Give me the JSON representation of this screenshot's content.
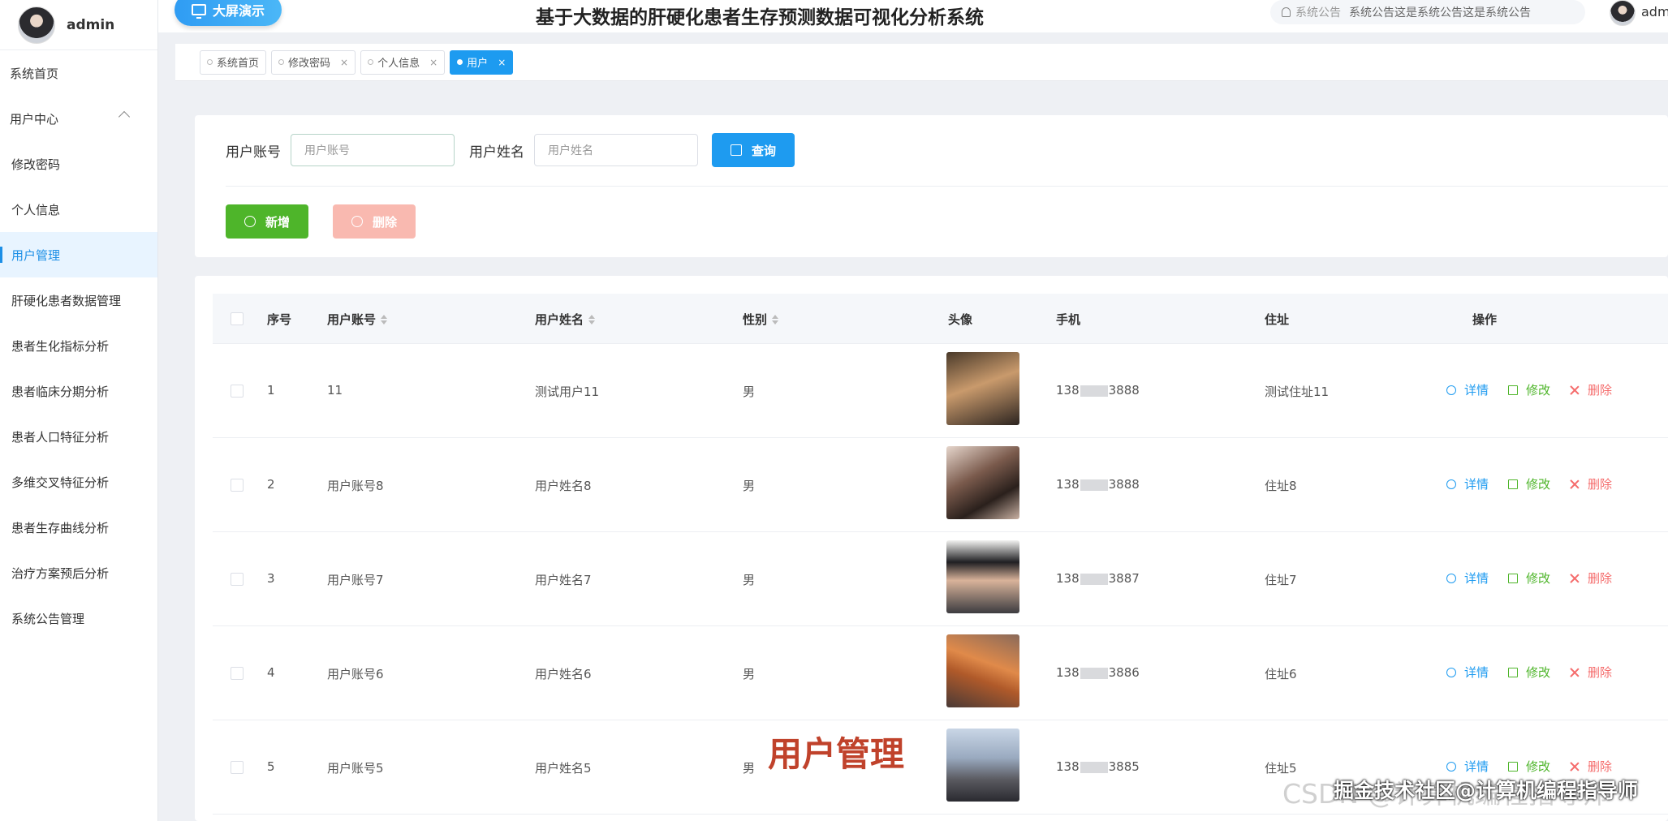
{
  "sidebar": {
    "username": "admin",
    "items": [
      {
        "label": "系统首页"
      },
      {
        "label": "用户中心"
      },
      {
        "label": "修改密码"
      },
      {
        "label": "个人信息"
      },
      {
        "label": "用户管理"
      },
      {
        "label": "肝硬化患者数据管理"
      },
      {
        "label": "患者生化指标分析"
      },
      {
        "label": "患者临床分期分析"
      },
      {
        "label": "患者人口特征分析"
      },
      {
        "label": "多维交叉特征分析"
      },
      {
        "label": "患者生存曲线分析"
      },
      {
        "label": "治疗方案预后分析"
      },
      {
        "label": "系统公告管理"
      }
    ]
  },
  "header": {
    "bigscreen_label": "大屏演示",
    "title": "基于大数据的肝硬化患者生存预测数据可视化分析系统",
    "notice_label": "系统公告",
    "notice_text": "系统公告这是系统公告这是系统公告",
    "user": "adm"
  },
  "tabs": [
    {
      "label": "系统首页",
      "closable": ""
    },
    {
      "label": "修改密码",
      "closable": "×"
    },
    {
      "label": "个人信息",
      "closable": "×"
    },
    {
      "label": "用户",
      "closable": "×"
    }
  ],
  "search": {
    "account_label": "用户账号",
    "account_placeholder": "用户账号",
    "name_label": "用户姓名",
    "name_placeholder": "用户姓名",
    "query_label": "查询",
    "add_label": "新增",
    "delete_label": "删除"
  },
  "table": {
    "columns": [
      "序号",
      "用户账号",
      "用户姓名",
      "性别",
      "头像",
      "手机",
      "住址",
      "操作"
    ],
    "actions": {
      "detail": "详情",
      "edit": "修改",
      "remove": "删除"
    },
    "rows": [
      {
        "index": "1",
        "account": "11",
        "name": "测试用户11",
        "gender": "男",
        "phone_pre": "138",
        "phone_post": "3888",
        "address": "测试住址11"
      },
      {
        "index": "2",
        "account": "用户账号8",
        "name": "用户姓名8",
        "gender": "男",
        "phone_pre": "138",
        "phone_post": "3888",
        "address": "住址8"
      },
      {
        "index": "3",
        "account": "用户账号7",
        "name": "用户姓名7",
        "gender": "男",
        "phone_pre": "138",
        "phone_post": "3887",
        "address": "住址7"
      },
      {
        "index": "4",
        "account": "用户账号6",
        "name": "用户姓名6",
        "gender": "男",
        "phone_pre": "138",
        "phone_post": "3886",
        "address": "住址6"
      },
      {
        "index": "5",
        "account": "用户账号5",
        "name": "用户姓名5",
        "gender": "男",
        "phone_pre": "138",
        "phone_post": "3885",
        "address": "住址5"
      }
    ]
  },
  "overlay": {
    "caption": "用户管理",
    "watermark": "CSDN @计算机编程指导师",
    "watermark2": "掘金技术社区@计算机编程指导师"
  },
  "colors": {
    "primary": "#1e9bf0",
    "success": "#4eb52a",
    "danger": "#f56c6c",
    "caption": "#c0422b"
  }
}
